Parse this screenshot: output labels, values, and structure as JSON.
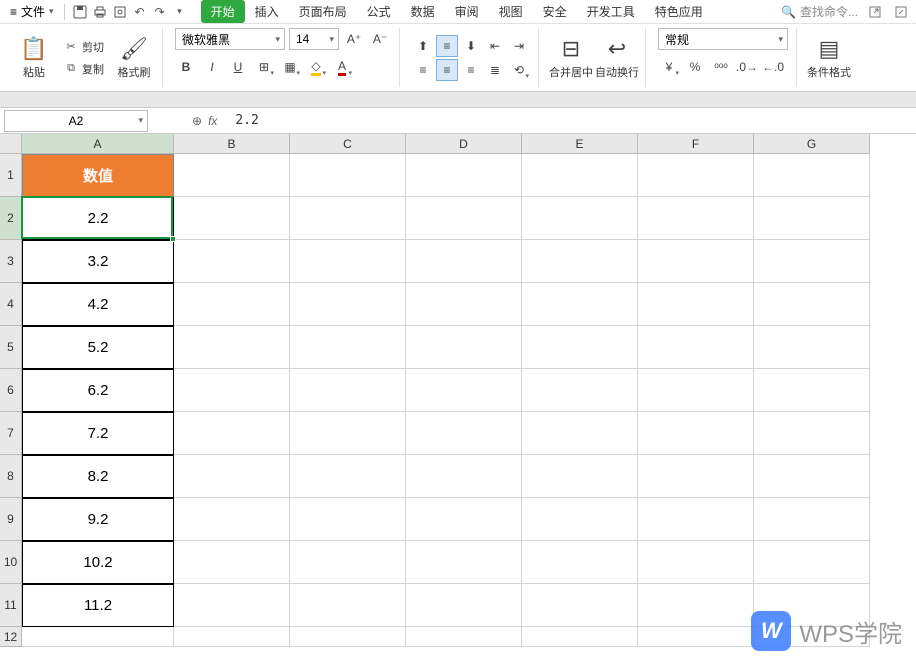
{
  "menu": {
    "file": "文件",
    "tabs": [
      "开始",
      "插入",
      "页面布局",
      "公式",
      "数据",
      "审阅",
      "视图",
      "安全",
      "开发工具",
      "特色应用"
    ],
    "active_tab": 0,
    "search_placeholder": "查找命令..."
  },
  "ribbon": {
    "paste": "粘贴",
    "cut": "剪切",
    "copy": "复制",
    "format_painter": "格式刷",
    "font_name": "微软雅黑",
    "font_size": "14",
    "merge_center": "合并居中",
    "auto_wrap": "自动换行",
    "number_format": "常规",
    "cond_format": "条件格式"
  },
  "formula": {
    "cell_ref": "A2",
    "value": "2.2"
  },
  "grid": {
    "col_widths": {
      "A": 152,
      "other": 116
    },
    "row_heights": {
      "data": 43,
      "small": 20
    },
    "columns": [
      "A",
      "B",
      "C",
      "D",
      "E",
      "F",
      "G"
    ],
    "header_label": "数值",
    "data": [
      "2.2",
      "3.2",
      "4.2",
      "5.2",
      "6.2",
      "7.2",
      "8.2",
      "9.2",
      "10.2",
      "11.2"
    ],
    "selected_cell": "A2",
    "row_count": 12
  },
  "watermark": "WPS学院"
}
